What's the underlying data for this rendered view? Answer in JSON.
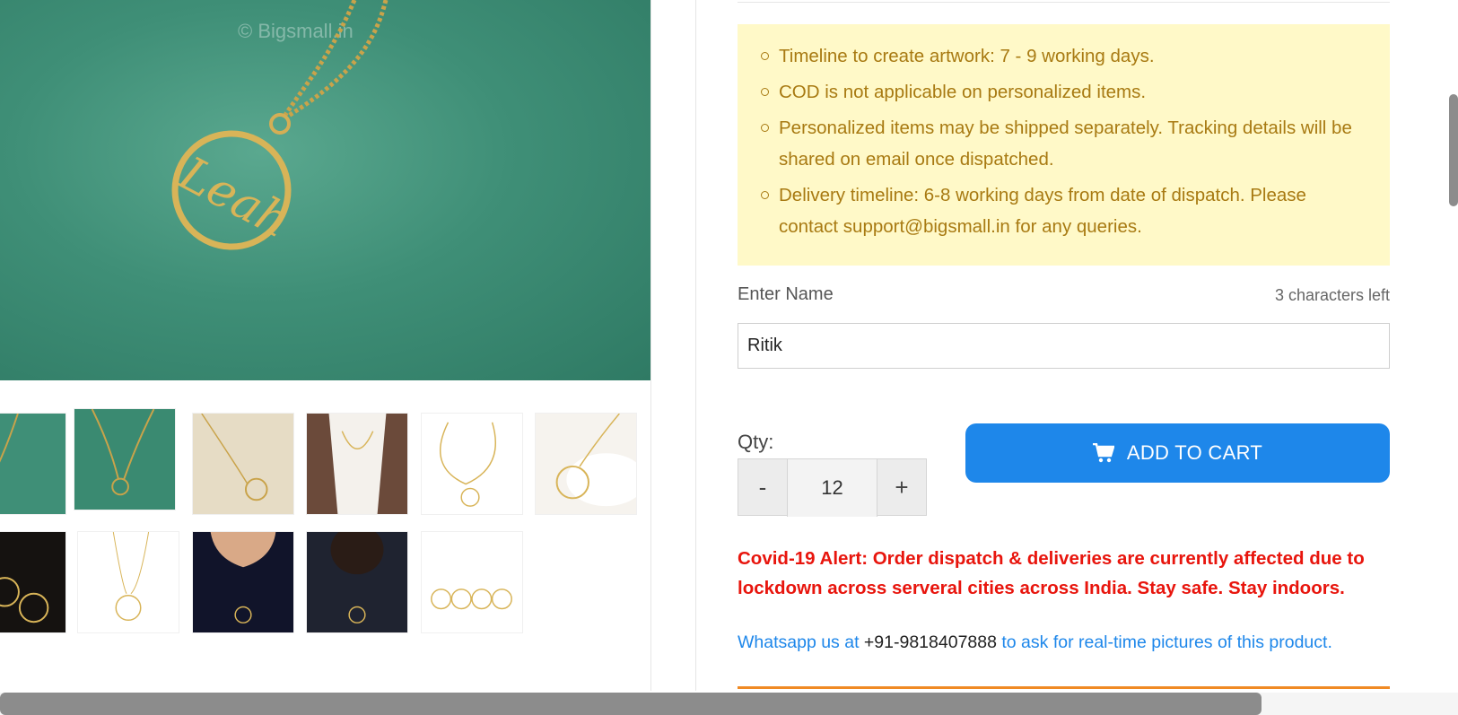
{
  "gallery": {
    "watermark": "© Bigsmall.in",
    "hero_name": "Leah"
  },
  "personalization": {
    "notes": [
      "Timeline to create artwork: 7 - 9 working days.",
      "COD is not applicable on personalized items.",
      "Personalized items may be shipped separately. Tracking details will be shared on email once dispatched.",
      "Delivery timeline: 6-8 working days from date of dispatch. Please contact support@bigsmall.in for any queries."
    ],
    "name_label": "Enter Name",
    "chars_left": "3 characters left",
    "name_value": "Ritik"
  },
  "quantity": {
    "label": "Qty:",
    "minus": "-",
    "value": "12",
    "plus": "+"
  },
  "cart": {
    "label": "ADD TO CART",
    "icon": "shopping-cart-icon"
  },
  "alert": {
    "text": "Covid-19 Alert: Order dispatch & deliveries are currently affected due to lockdown across serveral cities across India. Stay safe. Stay indoors."
  },
  "whatsapp": {
    "prefix": "Whatsapp us at",
    "phone": "+91-9818407888",
    "suffix": "to ask for real-time pictures of this product."
  },
  "colors": {
    "notice_bg": "#fff9c8",
    "notice_text": "#a87a12",
    "button": "#1e87ea",
    "alert": "#e8150d",
    "accent_rule": "#f08a24"
  }
}
